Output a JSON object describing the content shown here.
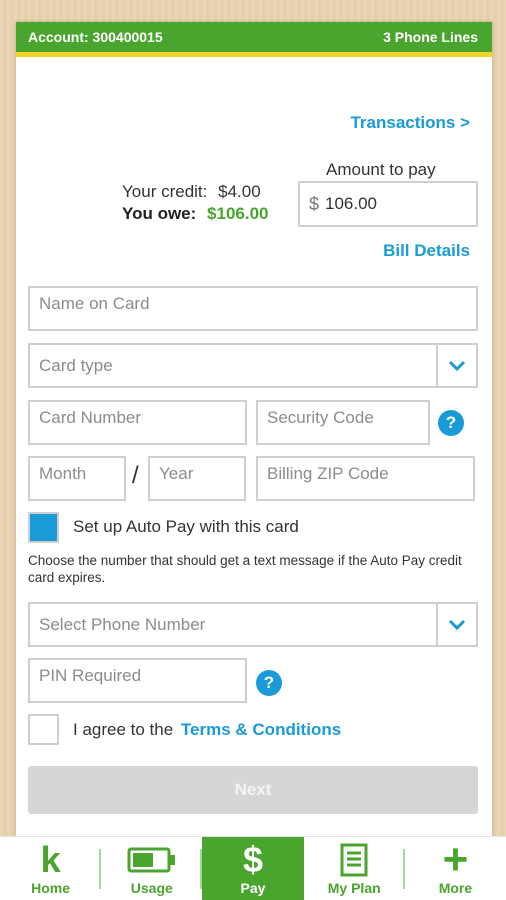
{
  "account": {
    "label": "Account: 300400015",
    "lines": "3 Phone Lines"
  },
  "transactions_link": "Transactions >",
  "credit": {
    "label": "Your credit:",
    "value": "$4.00"
  },
  "owe": {
    "label": "You owe:",
    "value": "$106.00"
  },
  "amount": {
    "label": "Amount to pay",
    "currency": "$",
    "value": "106.00"
  },
  "bill_details_link": "Bill Details",
  "form": {
    "name_on_card": "Name on Card",
    "card_type": "Card type",
    "card_number": "Card Number",
    "security_code": "Security Code",
    "month": "Month",
    "date_sep": "/",
    "year": "Year",
    "zip": "Billing ZIP Code",
    "autopay_label": "Set up Auto Pay with this card",
    "autopay_checked": true,
    "autopay_note": "Choose the number that should get a text message if the Auto Pay credit card expires.",
    "select_phone": "Select Phone Number",
    "pin": "PIN Required",
    "agree_prefix": "I agree to the",
    "terms_link": "Terms & Conditions",
    "agree_checked": false,
    "help_glyph": "?"
  },
  "next_label": "Next",
  "tabs": [
    {
      "label": "Home",
      "icon": "k-logo-icon",
      "glyph": "k"
    },
    {
      "label": "Usage",
      "icon": "battery-icon"
    },
    {
      "label": "Pay",
      "icon": "dollar-icon",
      "glyph": "$",
      "active": true
    },
    {
      "label": "My Plan",
      "icon": "document-icon"
    },
    {
      "label": "More",
      "icon": "plus-icon",
      "glyph": "+"
    }
  ],
  "colors": {
    "green": "#4aa52e",
    "blue": "#1a9bd7",
    "yellow": "#f4d327"
  }
}
